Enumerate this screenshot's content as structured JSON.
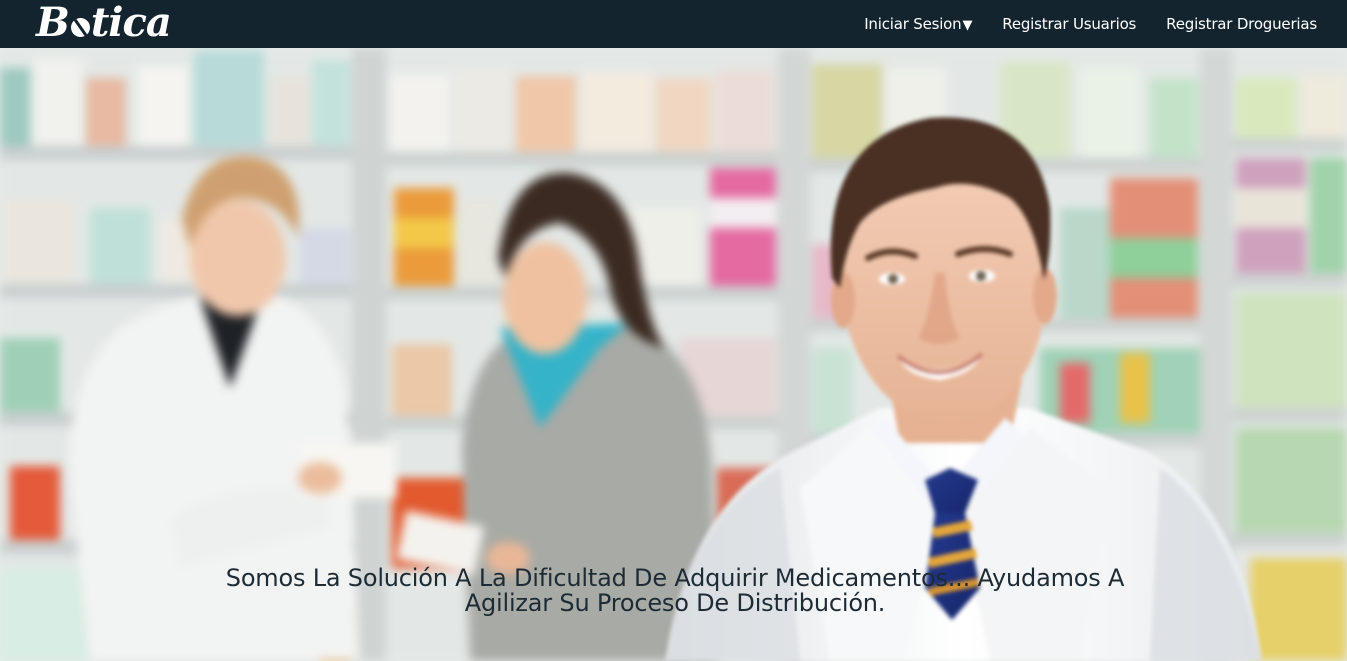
{
  "navbar": {
    "brand": "Botica",
    "links": [
      {
        "label": "Iniciar Sesion",
        "caret": "▼"
      },
      {
        "label": "Registrar Usuarios"
      },
      {
        "label": "Registrar Droguerias"
      }
    ]
  },
  "hero": {
    "caption": "Somos La Solución A La Dificultad De Adquirir Medicamentos... Ayudamos A Agilizar Su Proceso De Distribución."
  },
  "colors": {
    "navbar_bg": "#14242f",
    "nav_text": "#ffffff",
    "caption_text": "#1d2b35"
  }
}
